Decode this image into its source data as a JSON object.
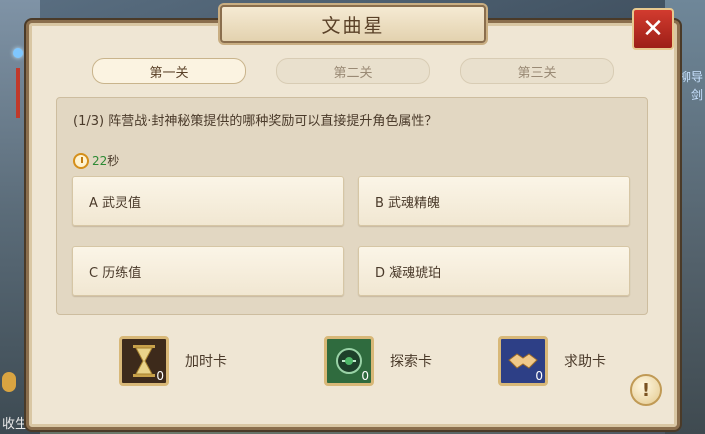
{
  "window": {
    "title": "文曲星"
  },
  "tabs": [
    {
      "label": "第一关",
      "active": true
    },
    {
      "label": "第二关",
      "active": false
    },
    {
      "label": "第三关",
      "active": false
    }
  ],
  "question": {
    "text": "(1/3) 阵营战·封神秘策提供的哪种奖励可以直接提升角色属性？",
    "timer_value": "22",
    "timer_unit": "秒"
  },
  "options": [
    {
      "label": "A 武灵值"
    },
    {
      "label": "B 武魂精魄"
    },
    {
      "label": "C 历练值"
    },
    {
      "label": "D 凝魂琥珀"
    }
  ],
  "items": [
    {
      "label": "加时卡",
      "count": "0",
      "icon": "hourglass-icon"
    },
    {
      "label": "探索卡",
      "count": "0",
      "icon": "compass-icon"
    },
    {
      "label": "求助卡",
      "count": "0",
      "icon": "handshake-icon"
    }
  ],
  "background": {
    "bottom_text": "收生",
    "right_text_1": "柳导",
    "right_text_2": "剑"
  },
  "colors": {
    "close": "#c0392b",
    "timer_num": "#2d8a34",
    "panel": "#efe6d4"
  }
}
